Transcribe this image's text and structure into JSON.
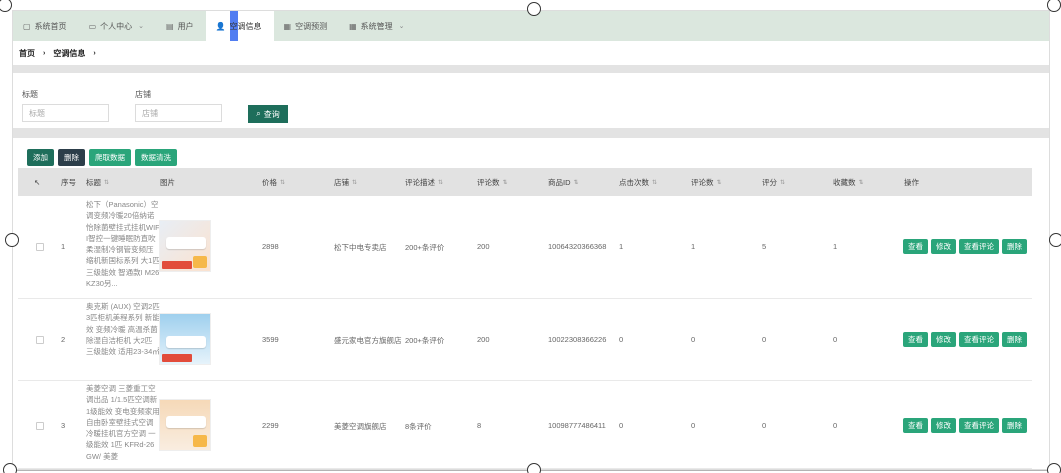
{
  "nav": {
    "items": [
      {
        "label": "系统首页",
        "icon": "document-icon"
      },
      {
        "label": "个人中心",
        "icon": "calendar-icon"
      },
      {
        "label": "用户",
        "icon": "film-icon"
      },
      {
        "label": "空调信息",
        "icon": "user-icon"
      },
      {
        "label": "空调预测",
        "icon": "printer-icon"
      },
      {
        "label": "系统管理",
        "icon": "grid-icon"
      }
    ]
  },
  "breadcrumb": {
    "home": "首页",
    "current": "空调信息"
  },
  "search": {
    "title_label": "标题",
    "title_placeholder": "标题",
    "store_label": "店铺",
    "store_placeholder": "店铺",
    "button": "查询"
  },
  "actions": {
    "add": "添加",
    "delete": "删除",
    "crawl": "爬取数据",
    "clean": "数据清洗"
  },
  "table": {
    "headers": [
      "序号",
      "标题",
      "图片",
      "价格",
      "店铺",
      "评论描述",
      "评论数",
      "商品ID",
      "点击次数",
      "评论数",
      "评分",
      "收藏数",
      "操作"
    ],
    "rows": [
      {
        "index": "1",
        "title": "松下（Panasonic）空调变频冷暖20倍纳诺怡除菌壁挂式挂机WIFI智控一键睡眠防直吹柔湿制冷钢管变频压缩机新国标系列 大1匹 三级能效 智通款I M26KZ30另...",
        "price": "2898",
        "store": "松下中电专卖店",
        "comment_desc": "200+条评价",
        "comments": "200",
        "product_id": "10064320366368",
        "clicks": "1",
        "reviews": "1",
        "score": "5",
        "favorites": "1"
      },
      {
        "index": "2",
        "title": "奥克斯 (AUX) 空调2匹3匹柜机美程系列 新能效 变频冷暖 高温杀菌 除湿自洁柜机 大2匹 三级能效 适用23-34㎡",
        "price": "3599",
        "store": "盛元家电官方旗舰店",
        "comment_desc": "200+条评价",
        "comments": "200",
        "product_id": "10022308366226",
        "clicks": "0",
        "reviews": "0",
        "score": "0",
        "favorites": "0"
      },
      {
        "index": "3",
        "title": "美菱空调 三菱重工空调出品 1/1.5匹空调新1级能效 变电变频家用自由卧室壁挂式空调冷暖挂机官方空调 一级能效 1匹 KFRd-26GW/ 美菱",
        "price": "2299",
        "store": "美菱空调旗舰店",
        "comment_desc": "8条评价",
        "comments": "8",
        "product_id": "10098777486411",
        "clicks": "0",
        "reviews": "0",
        "score": "0",
        "favorites": "0"
      }
    ],
    "row_ops": {
      "view": "查看",
      "edit": "修改",
      "view_comments": "查看评论",
      "delete": "删除"
    }
  },
  "colors": {
    "nav_bg": "#dbe7de",
    "primary": "#1e6e5b",
    "success": "#2aa57a",
    "dark": "#2c3e4a"
  }
}
